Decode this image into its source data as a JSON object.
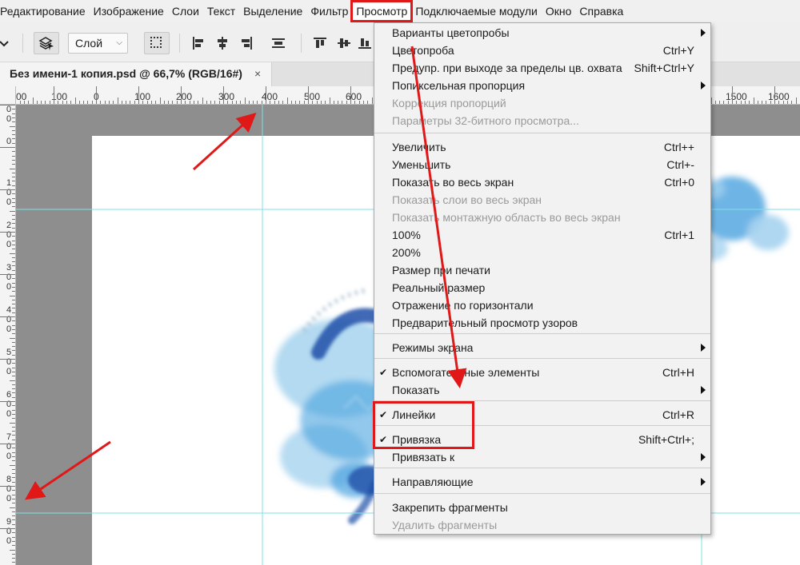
{
  "menubar": {
    "items": [
      {
        "label": "Редактирование"
      },
      {
        "label": "Изображение"
      },
      {
        "label": "Слои"
      },
      {
        "label": "Текст"
      },
      {
        "label": "Выделение"
      },
      {
        "label": "Фильтр"
      },
      {
        "label": "Просмотр"
      },
      {
        "label": "Подключаемые модули"
      },
      {
        "label": "Окно"
      },
      {
        "label": "Справка"
      }
    ]
  },
  "options": {
    "layer_select": "Слой"
  },
  "document_tab": {
    "title": "Без имени-1 копия.psd @ 66,7% (RGB/16#)",
    "close": "×"
  },
  "rulers": {
    "horizontal": [
      "00",
      "100",
      "0",
      "100",
      "200",
      "300",
      "400",
      "500",
      "600",
      "1500",
      "1600"
    ],
    "vertical": [
      "00",
      "0",
      "100",
      "200",
      "300",
      "400",
      "500",
      "600",
      "700",
      "800",
      "900"
    ]
  },
  "view_menu": {
    "items": [
      {
        "label": "Варианты цветопробы",
        "shortcut": "",
        "submenu": true,
        "disabled": false,
        "checked": false
      },
      {
        "label": "Цветопроба",
        "shortcut": "Ctrl+Y",
        "submenu": false,
        "disabled": false,
        "checked": false
      },
      {
        "label": "Предупр. при выходе за пределы цв. охвата",
        "shortcut": "Shift+Ctrl+Y",
        "submenu": false,
        "disabled": false,
        "checked": false
      },
      {
        "label": "Попиксельная пропорция",
        "shortcut": "",
        "submenu": true,
        "disabled": false,
        "checked": false
      },
      {
        "label": "Коррекция пропорций",
        "shortcut": "",
        "submenu": false,
        "disabled": true,
        "checked": false
      },
      {
        "label": "Параметры 32-битного просмотра...",
        "shortcut": "",
        "submenu": false,
        "disabled": true,
        "checked": false
      },
      {
        "label": "Увеличить",
        "shortcut": "Ctrl++",
        "submenu": false,
        "disabled": false,
        "checked": false
      },
      {
        "label": "Уменьшить",
        "shortcut": "Ctrl+-",
        "submenu": false,
        "disabled": false,
        "checked": false
      },
      {
        "label": "Показать во весь экран",
        "shortcut": "Ctrl+0",
        "submenu": false,
        "disabled": false,
        "checked": false
      },
      {
        "label": "Показать слои во весь экран",
        "shortcut": "",
        "submenu": false,
        "disabled": true,
        "checked": false
      },
      {
        "label": "Показать монтажную область во весь экран",
        "shortcut": "",
        "submenu": false,
        "disabled": true,
        "checked": false
      },
      {
        "label": "100%",
        "shortcut": "Ctrl+1",
        "submenu": false,
        "disabled": false,
        "checked": false
      },
      {
        "label": "200%",
        "shortcut": "",
        "submenu": false,
        "disabled": false,
        "checked": false
      },
      {
        "label": "Размер при печати",
        "shortcut": "",
        "submenu": false,
        "disabled": false,
        "checked": false
      },
      {
        "label": "Реальный размер",
        "shortcut": "",
        "submenu": false,
        "disabled": false,
        "checked": false
      },
      {
        "label": "Отражение по горизонтали",
        "shortcut": "",
        "submenu": false,
        "disabled": false,
        "checked": false
      },
      {
        "label": "Предварительный просмотр узоров",
        "shortcut": "",
        "submenu": false,
        "disabled": false,
        "checked": false
      },
      {
        "label": "Режимы экрана",
        "shortcut": "",
        "submenu": true,
        "disabled": false,
        "checked": false
      },
      {
        "label": "Вспомогательные элементы",
        "shortcut": "Ctrl+H",
        "submenu": false,
        "disabled": false,
        "checked": true
      },
      {
        "label": "Показать",
        "shortcut": "",
        "submenu": true,
        "disabled": false,
        "checked": false
      },
      {
        "label": "Линейки",
        "shortcut": "Ctrl+R",
        "submenu": false,
        "disabled": false,
        "checked": true
      },
      {
        "label": "Привязка",
        "shortcut": "Shift+Ctrl+;",
        "submenu": false,
        "disabled": false,
        "checked": true
      },
      {
        "label": "Привязать к",
        "shortcut": "",
        "submenu": true,
        "disabled": false,
        "checked": false
      },
      {
        "label": "Направляющие",
        "shortcut": "",
        "submenu": true,
        "disabled": false,
        "checked": false
      },
      {
        "label": "Закрепить фрагменты",
        "shortcut": "",
        "submenu": false,
        "disabled": false,
        "checked": false
      },
      {
        "label": "Удалить фрагменты",
        "shortcut": "",
        "submenu": false,
        "disabled": true,
        "checked": false
      }
    ]
  },
  "icons": {
    "check": "✔"
  },
  "colors": {
    "annotation_red": "#e01818",
    "guide_cyan": "#7fe0e8",
    "paint_blue": "#4aa3df",
    "paint_dark_blue": "#1f4fa8",
    "paint_light_blue": "#a6d3ef"
  }
}
